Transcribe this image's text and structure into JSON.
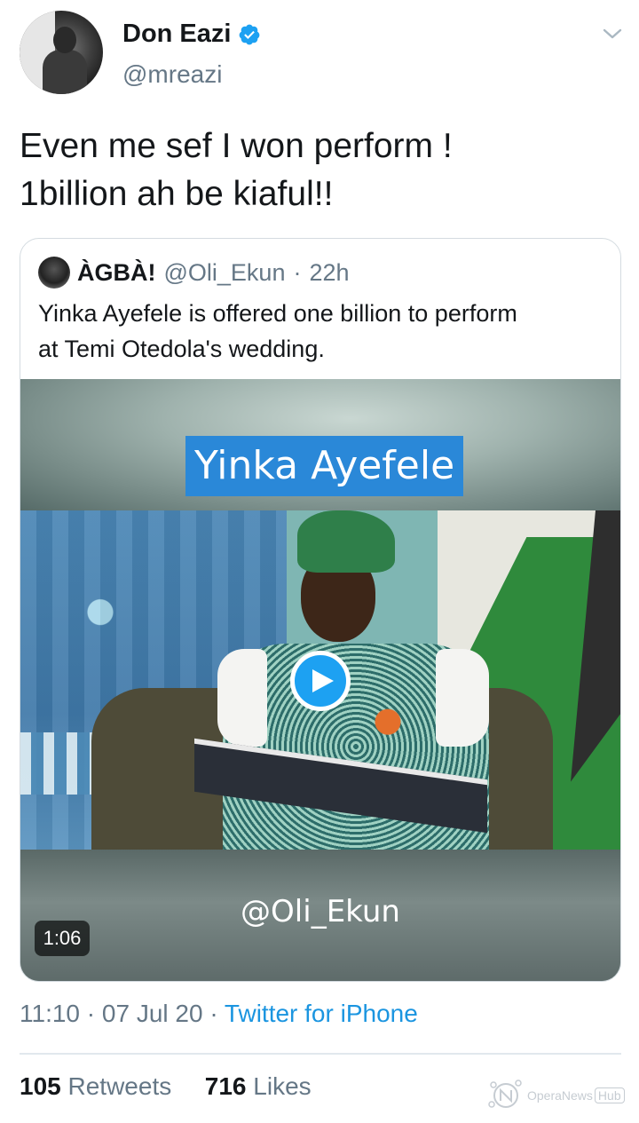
{
  "author": {
    "name": "Don Eazi",
    "handle": "@mreazi",
    "verified": true
  },
  "tweet": {
    "text_line1": "Even me sef I won perform !",
    "text_line2": "1billion ah be kiaful!!",
    "time": "11:10",
    "date": "07 Jul 20",
    "source": "Twitter for iPhone",
    "retweets": "105",
    "retweets_label": "Retweets",
    "likes": "716",
    "likes_label": "Likes"
  },
  "quoted": {
    "name": "ÀGBÀ!",
    "handle": "@Oli_Ekun",
    "age": "22h",
    "text_line1": "Yinka Ayefele is offered one billion to perform",
    "text_line2": "at Temi Otedola's wedding.",
    "video": {
      "caption_title": "Yinka Ayefele",
      "caption_credit": "@Oli_Ekun",
      "duration": "1:06"
    }
  },
  "watermark": {
    "brand": "OperaNews",
    "tag": "Hub"
  },
  "icons": {
    "verified": "verified-badge-icon",
    "menu": "chevron-down-icon",
    "play": "play-icon"
  },
  "colors": {
    "accent": "#1da1f2",
    "link": "#1b95e0",
    "muted": "#657786",
    "text": "#14171a"
  }
}
